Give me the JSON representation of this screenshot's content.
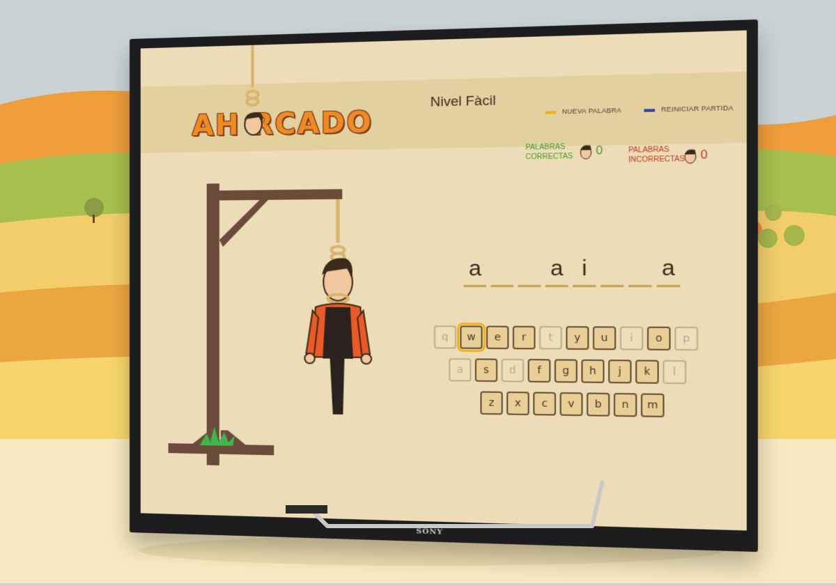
{
  "header": {
    "level_title": "Nivel Fàcil",
    "new_word_label": "NUEVA PALABRA",
    "reset_label": "REINICIAR PARTIDA"
  },
  "logo": {
    "text": "AH RCADO"
  },
  "scores": {
    "correct_label_line1": "PALABRAS",
    "correct_label_line2": "CORRECTAS",
    "correct_value": "0",
    "wrong_label_line1": "PALABRAS",
    "wrong_label_line2": "INCORRECTAS",
    "wrong_value": "0"
  },
  "word": {
    "slots": [
      "a",
      "",
      "",
      "a",
      "i",
      "",
      "",
      "a"
    ]
  },
  "keyboard": {
    "rows": [
      [
        {
          "k": "q",
          "state": "disabled"
        },
        {
          "k": "w",
          "state": "selected"
        },
        {
          "k": "e",
          "state": "active"
        },
        {
          "k": "r",
          "state": "active"
        },
        {
          "k": "t",
          "state": "disabled"
        },
        {
          "k": "y",
          "state": "active"
        },
        {
          "k": "u",
          "state": "active"
        },
        {
          "k": "i",
          "state": "disabled"
        },
        {
          "k": "o",
          "state": "active"
        },
        {
          "k": "p",
          "state": "disabled"
        }
      ],
      [
        {
          "k": "a",
          "state": "disabled"
        },
        {
          "k": "s",
          "state": "active"
        },
        {
          "k": "d",
          "state": "disabled"
        },
        {
          "k": "f",
          "state": "active"
        },
        {
          "k": "g",
          "state": "active"
        },
        {
          "k": "h",
          "state": "active"
        },
        {
          "k": "j",
          "state": "active"
        },
        {
          "k": "k",
          "state": "active"
        },
        {
          "k": "l",
          "state": "disabled"
        }
      ],
      [
        {
          "k": "z",
          "state": "active"
        },
        {
          "k": "x",
          "state": "active"
        },
        {
          "k": "c",
          "state": "active"
        },
        {
          "k": "v",
          "state": "active"
        },
        {
          "k": "b",
          "state": "active"
        },
        {
          "k": "n",
          "state": "active"
        },
        {
          "k": "m",
          "state": "active"
        }
      ]
    ]
  },
  "tv": {
    "brand": "SONY"
  },
  "colors": {
    "new_word_bar": "#f1b21a",
    "reset_bar": "#3b3f9e",
    "correct": "#4a9a2a",
    "wrong": "#c0392b"
  }
}
